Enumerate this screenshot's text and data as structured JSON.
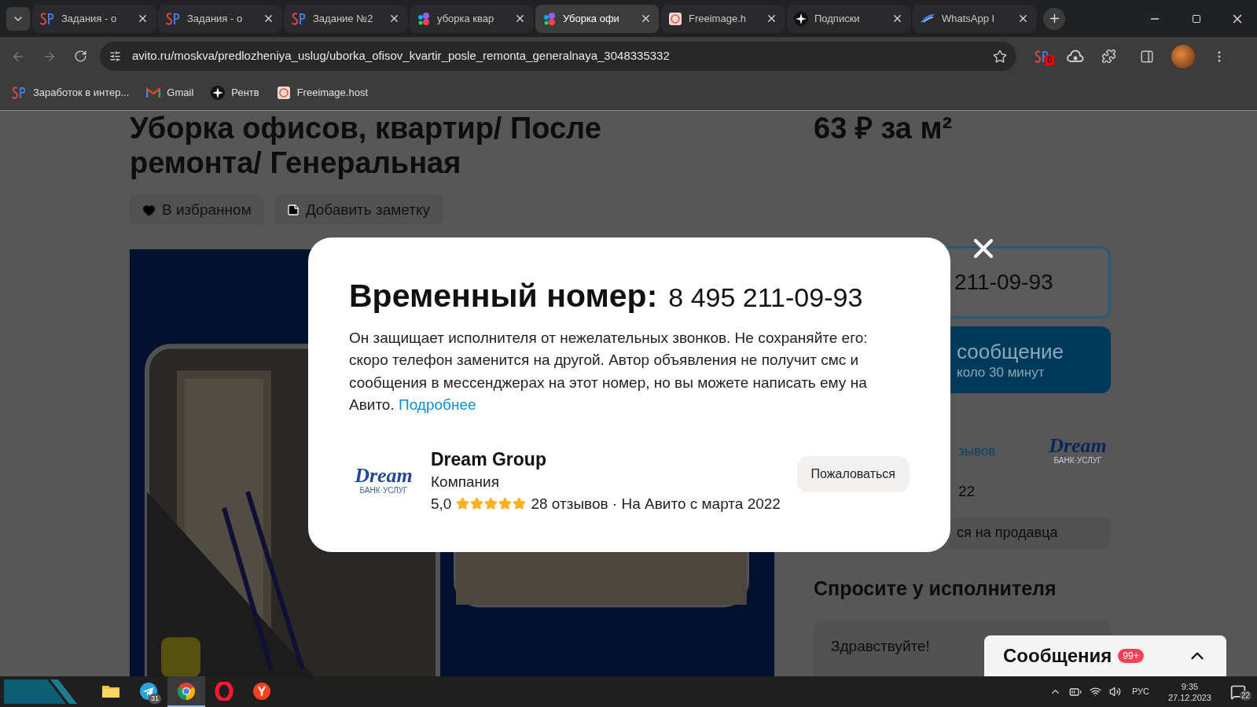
{
  "browser": {
    "tabs": [
      {
        "kind": "sp",
        "title": "Задания - о",
        "selected": false
      },
      {
        "kind": "sp",
        "title": "Задания - о",
        "selected": false
      },
      {
        "kind": "sp",
        "title": "Задание №2",
        "selected": false
      },
      {
        "kind": "avito",
        "title": "уборка квар",
        "selected": false
      },
      {
        "kind": "avito",
        "title": "Уборка офи",
        "selected": true
      },
      {
        "kind": "freeimage",
        "title": "Freeimage.h",
        "selected": false
      },
      {
        "kind": "spark",
        "title": "Подписки",
        "selected": false
      },
      {
        "kind": "whatsapp",
        "title": "WhatsApp I",
        "selected": false
      }
    ],
    "url": "avito.ru/moskva/predlozheniya_uslug/uborka_ofisov_kvartir_posle_remonta_generalnaya_3048335332",
    "extension_badge": "0",
    "bookmarks": [
      {
        "kind": "sp",
        "label": "Заработок в интер..."
      },
      {
        "kind": "gmail",
        "label": "Gmail"
      },
      {
        "kind": "spark",
        "label": "Рентв"
      },
      {
        "kind": "freeimage",
        "label": "Freeimage.host"
      }
    ]
  },
  "page": {
    "title": "Уборка офисов, квартир/ После ремонта/ Генеральная",
    "price": "63 ₽ за м²",
    "actions": [
      {
        "kind": "heart",
        "label": "В избранном"
      },
      {
        "kind": "note",
        "label": "Добавить заметку"
      }
    ],
    "phone_fragment": "211-09-93",
    "message_button": {
      "title": "сообщение",
      "subtitle": "коло 30 минут"
    },
    "reviews_fragment": "зывов",
    "logo": {
      "name": "Dream",
      "tagline": "БАНК·УСЛУГ"
    },
    "since_fragment": "22",
    "complain_fragment": "ся на продавца",
    "ask_heading": "Спросите у исполнителя",
    "ask_value": "Здравствуйте!",
    "messenger": {
      "title": "Сообщения",
      "badge": "99+"
    }
  },
  "modal": {
    "title": "Временный номер:",
    "phone": "8 495 211-09-93",
    "text": "Он защищает исполнителя от нежелательных звонков. Не сохраняйте его: скоро телефон заменится на другой. Автор объявления не получит смс и сообщения в мессенджерах на этот номер, но вы можете написать ему на Авито.",
    "link": "Подробнее",
    "seller": {
      "logo": {
        "name": "Dream",
        "tagline": "БАНК·УСЛУГ"
      },
      "name": "Dream Group",
      "type": "Компания",
      "rating": "5,0",
      "stars": 5,
      "meta": "28 отзывов · На Авито с марта 2022"
    },
    "complain": "Пожаловаться"
  },
  "taskbar": {
    "apps": [
      {
        "kind": "folder",
        "selected": false
      },
      {
        "kind": "telegram",
        "badge": "31",
        "selected": false
      },
      {
        "kind": "chrome",
        "selected": true
      },
      {
        "kind": "opera",
        "selected": false
      },
      {
        "kind": "yandex",
        "selected": false
      }
    ],
    "language": "РУС",
    "time": "9:35",
    "date": "27.12.2023",
    "notifications": "22"
  }
}
